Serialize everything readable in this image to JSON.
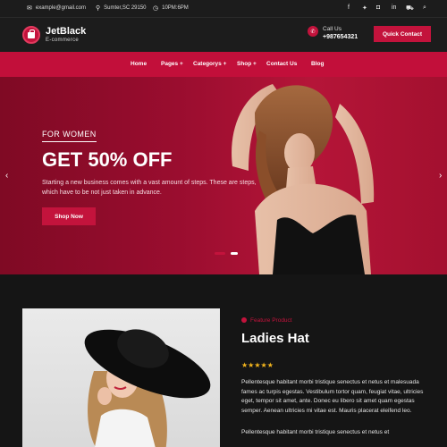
{
  "topbar": {
    "email": "example@gmail.com",
    "location": "Sumter,SC 29150",
    "time": "10PM:6PM",
    "social_icons": [
      "facebook-icon",
      "twitter-icon",
      "instagram-icon",
      "linkedin-icon",
      "cart-icon",
      "search-icon"
    ]
  },
  "brand": {
    "name": "JetBlack",
    "tagline": "E-commerce",
    "accent": "#c3133c"
  },
  "contact": {
    "label": "Call Us",
    "number": "+987654321",
    "button": "Quick Contact"
  },
  "nav": {
    "items": [
      "Home",
      "Pages +",
      "Categorys +",
      "Shop +",
      "Contact Us",
      "Blog"
    ]
  },
  "hero": {
    "kicker": "FOR WOMEN",
    "title": "GET 50% OFF",
    "description": "Starting a new business comes with a vast amount of steps. These are steps, which have to be not just taken in advance.",
    "button": "Shop Now",
    "slides": 2,
    "active_slide": 1
  },
  "feature": {
    "label": "Feature Product",
    "title": "Ladies Hat",
    "rating": 5,
    "stars": "★★★★★",
    "paragraph1": "Pellentesque habitant morbi tristique senectus et netus et malesuada fames ac turpis egestas. Vestibulum tortor quam, feugiat vitae, ultricies eget, tempor sit amet, ante. Donec eu libero sit amet quam egestas semper. Aenean ultricies mi vitae est. Mauris placerat eleifend leo.",
    "paragraph2": "Pellentesque habitant morbi tristique senectus et netus et"
  }
}
